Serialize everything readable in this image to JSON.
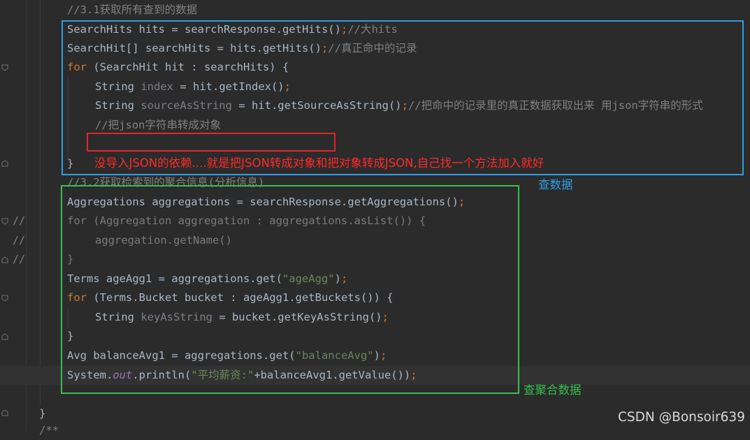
{
  "editor": {
    "lines": {
      "c31": "//3.1获取所有查到的数据",
      "hits_type": "SearchHits",
      "hits_name": " hits = searchResponse.getHits()",
      "hits_cmt": "//大hits",
      "arr_type": "SearchHit[] searchHits = hits.getHits()",
      "arr_cmt": "//真正命中的记录",
      "for1_kw": "for",
      "for1_rest": " (SearchHit hit : searchHits) {",
      "idx_type": "String ",
      "idx_var": "index",
      "idx_rest": " = hit.getIndex()",
      "src_type": "String ",
      "src_var": "sourceAsString",
      "src_rest": " = hit.getSourceAsString()",
      "src_cmt": "//把命中的记录里的真正数据获取出来 用json字符串的形式",
      "json_cmt": "//把json字符串转成对象",
      "close1": "}",
      "c32": "//3.2获取检索到的聚合信息(分析信息)",
      "aggs": "Aggregations aggregations = searchResponse.getAggregations()",
      "for_cmt": "for (Aggregation aggregation : aggregations.asList()) {",
      "getname_cmt": "aggregation.getName()",
      "close_cmt": "}",
      "terms_pre": "Terms ageAgg1 = aggregations.get(",
      "terms_str": "\"ageAgg\"",
      "terms_post": ")",
      "for2_kw": "for",
      "for2_rest": " (Terms.Bucket bucket : ageAgg1.getBuckets()) {",
      "key_type": "String ",
      "key_var": "keyAsString",
      "key_rest": " = bucket.getKeyAsString()",
      "close2": "}",
      "avg_pre": "Avg balanceAvg1 = aggregations.get(",
      "avg_str": "\"balanceAvg\"",
      "avg_post": ")",
      "sys_pre": "System.",
      "sys_fld": "out",
      "sys_mid": ".println(",
      "sys_str": "\"平均薪资:\"",
      "sys_post": "+balanceAvg1.getValue())",
      "semi": ";",
      "close_class": "}",
      "tail_cmt": "/**"
    },
    "gutter_comment_mark": "//"
  },
  "annotations": {
    "red_note": "没导入JSON的依赖....就是把JSON转成对象和把对象转成JSON,自己找一个方法加入就好",
    "blue_label": "查数据",
    "green_label": "查聚合数据"
  },
  "watermark": "CSDN @Bonsoir639",
  "colors": {
    "background": "#2b2b2b",
    "keyword": "#cc7832",
    "comment": "#808080",
    "string": "#6a8759",
    "field": "#9876aa",
    "box_blue": "#2d9ee6",
    "box_green": "#34c04a",
    "box_red": "#e0262c"
  },
  "icons": [
    "fold-marker-icon"
  ]
}
